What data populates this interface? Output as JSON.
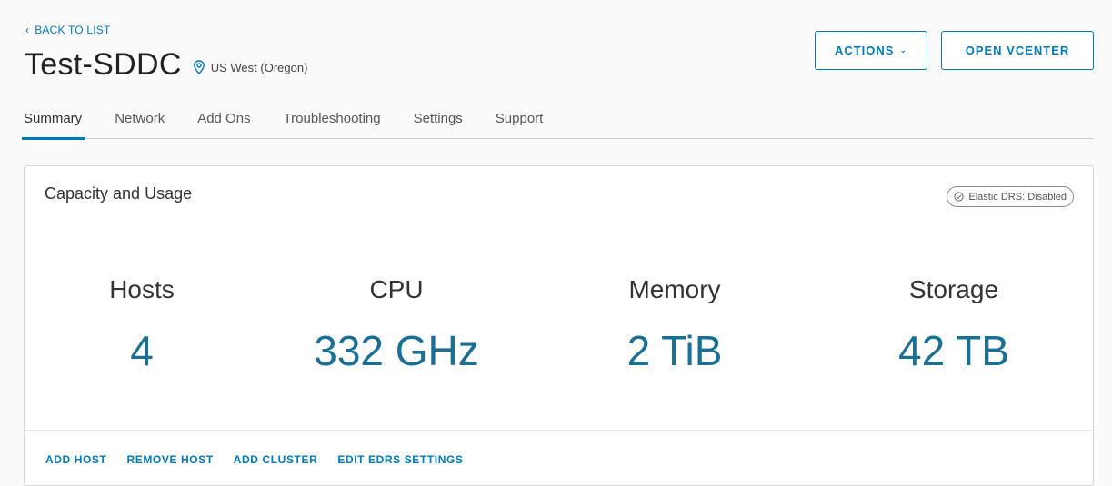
{
  "nav": {
    "back_label": "BACK TO LIST"
  },
  "header": {
    "title": "Test-SDDC",
    "region": "US West (Oregon)",
    "actions_label": "ACTIONS",
    "open_vcenter_label": "OPEN VCENTER"
  },
  "tabs": [
    {
      "label": "Summary",
      "active": true
    },
    {
      "label": "Network"
    },
    {
      "label": "Add Ons"
    },
    {
      "label": "Troubleshooting"
    },
    {
      "label": "Settings"
    },
    {
      "label": "Support"
    }
  ],
  "card": {
    "title": "Capacity and Usage",
    "edrs_badge": "Elastic DRS: Disabled",
    "metrics": [
      {
        "label": "Hosts",
        "value": "4"
      },
      {
        "label": "CPU",
        "value": "332 GHz"
      },
      {
        "label": "Memory",
        "value": "2 TiB"
      },
      {
        "label": "Storage",
        "value": "42 TB"
      }
    ],
    "footer_links": [
      {
        "label": "ADD HOST"
      },
      {
        "label": "REMOVE HOST"
      },
      {
        "label": "ADD CLUSTER"
      },
      {
        "label": "EDIT EDRS SETTINGS"
      }
    ]
  },
  "colors": {
    "accent": "#0079b8",
    "metric_value": "#1a6f95"
  },
  "icons": [
    "chevron-left-icon",
    "map-pin-icon",
    "chevron-down-icon",
    "check-circle-icon"
  ]
}
